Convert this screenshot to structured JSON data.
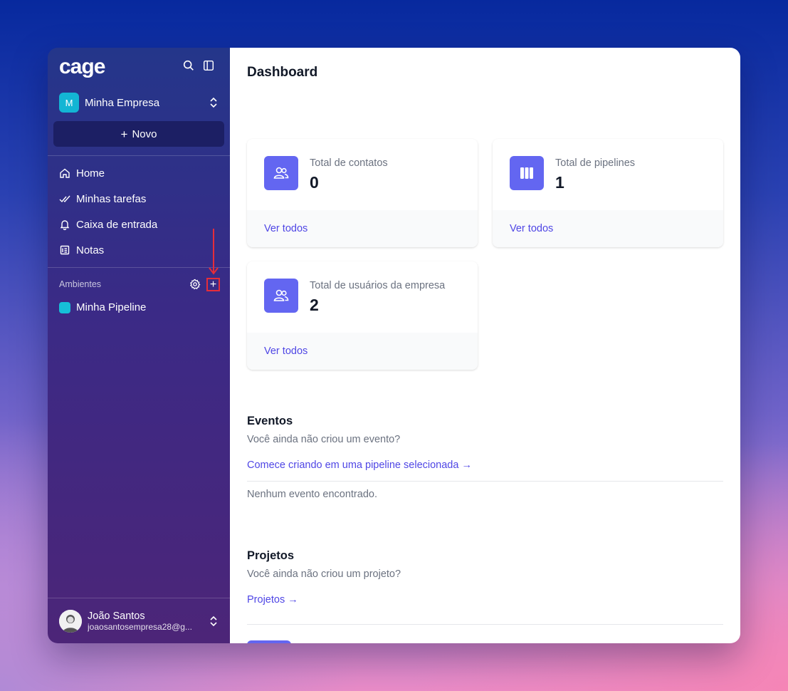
{
  "sidebar": {
    "logo": "cage",
    "company": {
      "initial": "M",
      "name": "Minha Empresa"
    },
    "new_button": "Novo",
    "nav": [
      {
        "label": "Home",
        "icon": "home-icon"
      },
      {
        "label": "Minhas tarefas",
        "icon": "double-check-icon"
      },
      {
        "label": "Caixa de entrada",
        "icon": "bell-icon"
      },
      {
        "label": "Notas",
        "icon": "notes-icon"
      }
    ],
    "section_title": "Ambientes",
    "pipelines": [
      {
        "label": "Minha Pipeline",
        "color": "#16bfd8"
      }
    ],
    "user": {
      "name": "João Santos",
      "email": "joaosantosempresa28@g..."
    }
  },
  "main": {
    "title": "Dashboard",
    "cards": [
      {
        "label": "Total de contatos",
        "value": "0",
        "link": "Ver todos",
        "icon": "users-icon"
      },
      {
        "label": "Total de pipelines",
        "value": "1",
        "link": "Ver todos",
        "icon": "columns-icon"
      },
      {
        "label": "Total de usuários da empresa",
        "value": "2",
        "link": "Ver todos",
        "icon": "users-icon"
      }
    ],
    "events": {
      "title": "Eventos",
      "subtitle": "Você ainda não criou um evento?",
      "link": "Comece criando em uma pipeline selecionada →",
      "empty": "Nenhum evento encontrado."
    },
    "projects": {
      "title": "Projetos",
      "subtitle": "Você ainda não criou um projeto?",
      "link": "Projetos →"
    }
  },
  "colors": {
    "accent": "#6366f1",
    "link": "#4f46e5",
    "highlight": "#e52d3a"
  }
}
